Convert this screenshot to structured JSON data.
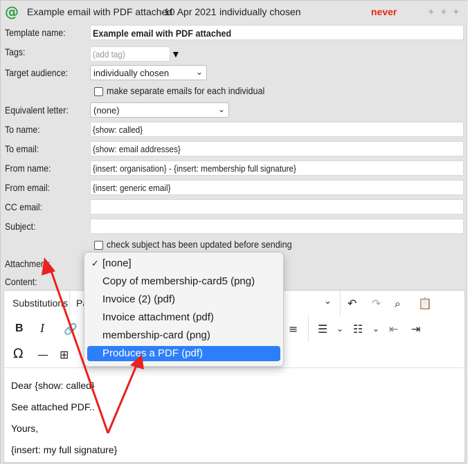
{
  "header": {
    "icon": "at-icon",
    "title": "Example email with PDF attached",
    "date": "10 Apr 2021",
    "audience": "individually chosen",
    "status": "never"
  },
  "form": {
    "template_name_label": "Template name:",
    "template_name_value": "Example email with PDF attached",
    "tags_label": "Tags:",
    "tags_placeholder": "(add tag)",
    "target_label": "Target audience:",
    "target_value": "individually chosen",
    "separate_label": "make separate emails for each individual",
    "equiv_label": "Equivalent letter:",
    "equiv_value": "(none)",
    "to_name_label": "To name:",
    "to_name_value": "{show: called}",
    "to_email_label": "To email:",
    "to_email_value": "{show: email addresses}",
    "from_name_label": "From name:",
    "from_name_value": "{insert: organisation} - {insert: membership full signature}",
    "from_email_label": "From email:",
    "from_email_value": "{insert: generic email}",
    "cc_label": "CC email:",
    "subject_label": "Subject:",
    "check_subject_label": "check subject has been updated before sending",
    "attachment_label": "Attachment:",
    "content_label": "Content:"
  },
  "toolbar": {
    "substitutions": "Substitutions",
    "paragraph_partial": "Pa"
  },
  "editor": {
    "lines": [
      "Dear {show: called}",
      "See attached PDF..",
      "Yours,",
      "{insert: my full signature}"
    ]
  },
  "dropdown": {
    "options": [
      {
        "label": "[none]",
        "checked": true
      },
      {
        "label": "Copy of membership-card5 (png)"
      },
      {
        "label": "Invoice (2) (pdf)"
      },
      {
        "label": "Invoice attachment (pdf)"
      },
      {
        "label": "membership-card (png)"
      },
      {
        "label": "Produces a PDF (pdf)",
        "highlighted": true
      }
    ]
  },
  "colors": {
    "panel": "#e4e4e4",
    "status_never": "#e02d12",
    "at_icon": "#2ea043",
    "highlight": "#2d7ff9",
    "arrow": "#e8221c"
  }
}
